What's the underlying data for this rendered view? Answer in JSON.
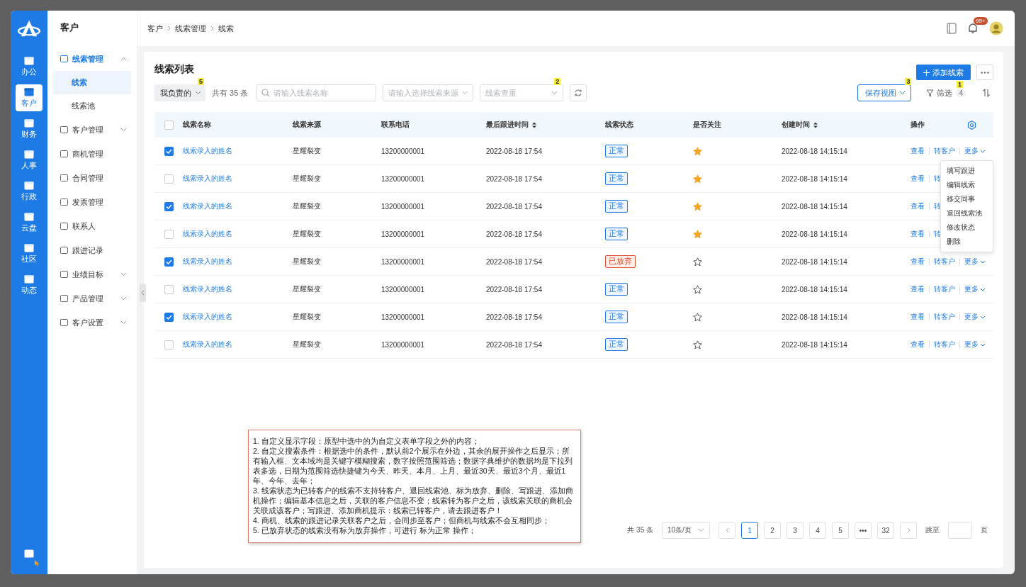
{
  "rail": {
    "items": [
      {
        "label": "办公",
        "selected": false
      },
      {
        "label": "客户",
        "selected": true
      },
      {
        "label": "财务",
        "selected": false
      },
      {
        "label": "人事",
        "selected": false
      },
      {
        "label": "行政",
        "selected": false
      },
      {
        "label": "云盘",
        "selected": false
      },
      {
        "label": "社区",
        "selected": false
      },
      {
        "label": "动态",
        "selected": false
      }
    ]
  },
  "sidebar": {
    "title": "客户",
    "items": [
      {
        "label": "线索管理",
        "expanded": true,
        "children": [
          {
            "label": "线索",
            "selected": true
          },
          {
            "label": "线索池",
            "selected": false
          }
        ]
      },
      {
        "label": "客户管理",
        "expanded": false
      },
      {
        "label": "商机管理"
      },
      {
        "label": "合同管理"
      },
      {
        "label": "发票管理"
      },
      {
        "label": "联系人"
      },
      {
        "label": "跟进记录"
      },
      {
        "label": "业绩目标",
        "expanded": false
      },
      {
        "label": "产品管理",
        "expanded": false
      },
      {
        "label": "客户设置",
        "expanded": false
      }
    ]
  },
  "breadcrumb": [
    "客户",
    "线索管理",
    "线索"
  ],
  "header": {
    "notification_badge": "99+"
  },
  "page_title": "线索列表",
  "toolbar": {
    "owner_filter": {
      "value": "我负责的",
      "marker": "5"
    },
    "total": "共有 35 条",
    "search": {
      "placeholder": "请输入线索名称"
    },
    "source_select": {
      "placeholder": "请输入选择线索来源"
    },
    "dedupe_select": {
      "placeholder": "线索查重",
      "marker": "2"
    },
    "add_button": "添加线索",
    "save_view": {
      "label": "保存视图",
      "marker": "3"
    },
    "filter": {
      "label": "筛选",
      "count": "4",
      "marker": "1"
    }
  },
  "table": {
    "all_checked": false,
    "columns": [
      {
        "label": "线索名称",
        "sortable": false
      },
      {
        "label": "线索来源",
        "sortable": false
      },
      {
        "label": "联系电话",
        "sortable": false
      },
      {
        "label": "最后跟进时间",
        "sortable": true
      },
      {
        "label": "线索状态",
        "sortable": false
      },
      {
        "label": "是否关注",
        "sortable": false
      },
      {
        "label": "创建时间",
        "sortable": true
      },
      {
        "label": "操作",
        "sortable": false
      }
    ],
    "rows": [
      {
        "checked": true,
        "name": "线索录入的姓名",
        "source": "星耀裂变",
        "phone": "13200000001",
        "last_follow": "2022-08-18 17:54",
        "status": {
          "text": "正常",
          "kind": "normal"
        },
        "starred": true,
        "created": "2022-08-18 14:15:14",
        "actions": [
          "查看",
          "转客户",
          "更多"
        ]
      },
      {
        "checked": false,
        "name": "线索录入的姓名",
        "source": "星耀裂变",
        "phone": "13200000001",
        "last_follow": "2022-08-18 17:54",
        "status": {
          "text": "正常",
          "kind": "normal"
        },
        "starred": true,
        "created": "2022-08-18 14:15:14",
        "actions": [
          "查看",
          "转"
        ]
      },
      {
        "checked": true,
        "name": "线索录入的姓名",
        "source": "星耀裂变",
        "phone": "13200000001",
        "last_follow": "2022-08-18 17:54",
        "status": {
          "text": "正常",
          "kind": "normal"
        },
        "starred": true,
        "created": "2022-08-18 14:15:14",
        "actions": [
          "查看",
          "转"
        ]
      },
      {
        "checked": false,
        "name": "线索录入的姓名",
        "source": "星耀裂变",
        "phone": "13200000001",
        "last_follow": "2022-08-18 17:54",
        "status": {
          "text": "正常",
          "kind": "normal"
        },
        "starred": true,
        "created": "2022-08-18 14:15:14",
        "actions": [
          "查看",
          "转"
        ]
      },
      {
        "checked": true,
        "name": "线索录入的姓名",
        "source": "星耀裂变",
        "phone": "13200000001",
        "last_follow": "2022-08-18 17:54",
        "status": {
          "text": "已放弃",
          "kind": "abandoned"
        },
        "starred": false,
        "created": "2022-08-18 14:15:14",
        "actions": [
          "查看",
          "转客户",
          "更多"
        ]
      },
      {
        "checked": false,
        "name": "线索录入的姓名",
        "source": "星耀裂变",
        "phone": "13200000001",
        "last_follow": "2022-08-18 17:54",
        "status": {
          "text": "正常",
          "kind": "normal"
        },
        "starred": false,
        "created": "2022-08-18 14:15:14",
        "actions": [
          "查看",
          "转客户",
          "更多"
        ]
      },
      {
        "checked": true,
        "name": "线索录入的姓名",
        "source": "星耀裂变",
        "phone": "13200000001",
        "last_follow": "2022-08-18 17:54",
        "status": {
          "text": "正常",
          "kind": "normal"
        },
        "starred": false,
        "created": "2022-08-18 14:15:14",
        "actions": [
          "查看",
          "转客户",
          "更多"
        ]
      },
      {
        "checked": false,
        "name": "线索录入的姓名",
        "source": "星耀裂变",
        "phone": "13200000001",
        "last_follow": "2022-08-18 17:54",
        "status": {
          "text": "正常",
          "kind": "normal"
        },
        "starred": false,
        "created": "2022-08-18 14:15:14",
        "actions": [
          "查看",
          "转客户",
          "更多"
        ]
      }
    ]
  },
  "more_menu": [
    "填写跟进",
    "编辑线索",
    "移交同事",
    "退回线索池",
    "修改状态",
    "删除"
  ],
  "notes": [
    "1. 自定义显示字段：原型中选中的为自定义表单字段之外的内容；",
    "2. 自定义搜索条件：根据选中的条件，默认前2个展示在外边，其余的展开操作之后显示；所有输入框、文本域均是关键字模糊搜索，数字按照范围筛选；数据字典维护的数据均是下拉列表多选，日期为范围筛选快捷键为今天、昨天、本月、上月、最近30天、最近3个月、最近1年、今年、去年；",
    "3. 线索状态为已转客户的线索不支持转客户、退回线索池、标为放弃、删除、写跟进、添加商机操作；编辑基本信息之后，关联的客户信息不变；线索转为客户之后，该线索关联的商机会关联成该客户；写跟进、添加商机提示：线索已转客户，请去跟进客户！",
    "4. 商机、线索的跟进记录关联客户之后，会同步至客户；但商机与线索不会互相同步；",
    "5. 已放弃状态的线索没有标为放弃操作，可进行 标为正常 操作；"
  ],
  "pagination": {
    "total": "共 35 条",
    "page_size": "10条/页",
    "pages": [
      {
        "label": "1",
        "selected": true
      },
      {
        "label": "2",
        "selected": false
      },
      {
        "label": "3",
        "selected": false
      },
      {
        "label": "4",
        "selected": false
      },
      {
        "label": "5",
        "selected": false
      },
      {
        "label": "•••",
        "selected": false
      },
      {
        "label": "32",
        "selected": false
      }
    ],
    "jump_label": "跳至",
    "jump_suffix": "页"
  }
}
